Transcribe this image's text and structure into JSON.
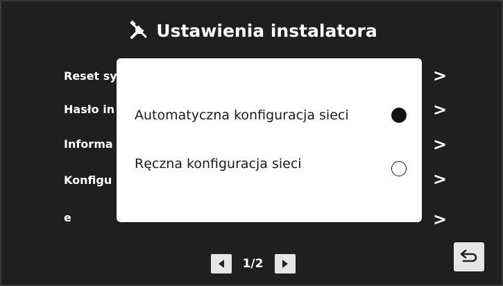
{
  "header": {
    "title": "Ustawienia instalatora",
    "icon": "tools-icon"
  },
  "menu": {
    "items": [
      {
        "label": "Reset sy"
      },
      {
        "label": "Hasło in"
      },
      {
        "label": "Informa"
      },
      {
        "label": "Konfigu"
      },
      {
        "label": "e"
      }
    ],
    "chevron": ">"
  },
  "modal": {
    "options": [
      {
        "label": "Automatyczna konfiguracja sieci",
        "selected": true
      },
      {
        "label": "Ręczna konfiguracja sieci",
        "selected": false
      }
    ]
  },
  "pager": {
    "page_label": "1/2",
    "prev_icon": "triangle-left-icon",
    "next_icon": "triangle-right-icon"
  },
  "back": {
    "icon": "return-arrow-icon"
  },
  "colors": {
    "background": "#1f1f1f",
    "text": "#ffffff",
    "modal_bg": "#ffffff",
    "button_bg": "#e6e6e6"
  }
}
